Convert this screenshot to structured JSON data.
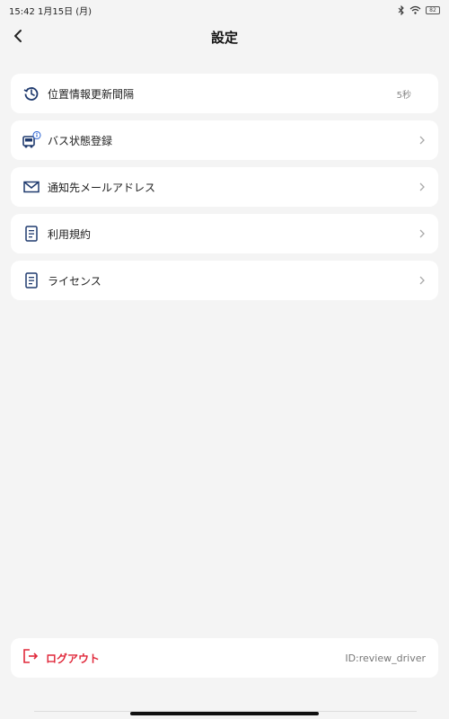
{
  "status_bar": {
    "datetime": "15:42 1月15日 (月)",
    "battery": "82"
  },
  "header": {
    "title": "設定"
  },
  "menu": [
    {
      "label": "位置情報更新間隔",
      "value": "5秒",
      "icon": "history-clock-icon"
    },
    {
      "label": "バス状態登録",
      "value": "",
      "icon": "bus-info-icon"
    },
    {
      "label": "通知先メールアドレス",
      "value": "",
      "icon": "mail-icon"
    },
    {
      "label": "利用規約",
      "value": "",
      "icon": "document-icon"
    },
    {
      "label": "ライセンス",
      "value": "",
      "icon": "document-icon"
    }
  ],
  "logout": {
    "label": "ログアウト",
    "user_id": "ID:review_driver",
    "color": "#e0283a"
  },
  "colors": {
    "background": "#f4f4f4",
    "card": "#ffffff",
    "icon": "#1f3a6e",
    "accent_red": "#e0283a"
  }
}
